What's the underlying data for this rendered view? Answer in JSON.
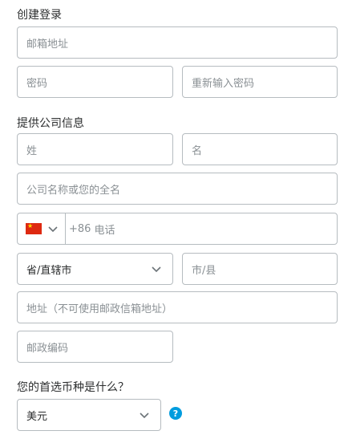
{
  "account": {
    "heading": "创建登录",
    "email_placeholder": "邮箱地址",
    "password_placeholder": "密码",
    "confirm_password_placeholder": "重新输入密码"
  },
  "company": {
    "heading": "提供公司信息",
    "last_name_placeholder": "姓",
    "first_name_placeholder": "名",
    "company_name_placeholder": "公司名称或您的全名",
    "country_flag": "china-flag",
    "phone_prefix": "+86",
    "phone_placeholder": "电话",
    "province_value": "省/直辖市",
    "city_placeholder": "市/县",
    "address_placeholder": "地址（不可使用邮政信箱地址）",
    "postal_code_placeholder": "邮政编码"
  },
  "currency": {
    "heading": "您的首选币种是什么？",
    "selected": "美元",
    "help_symbol": "?"
  },
  "colors": {
    "border": "#b6bcc0",
    "placeholder": "#8a9094",
    "help_blue": "#009cde",
    "flag_red": "#de2910"
  }
}
